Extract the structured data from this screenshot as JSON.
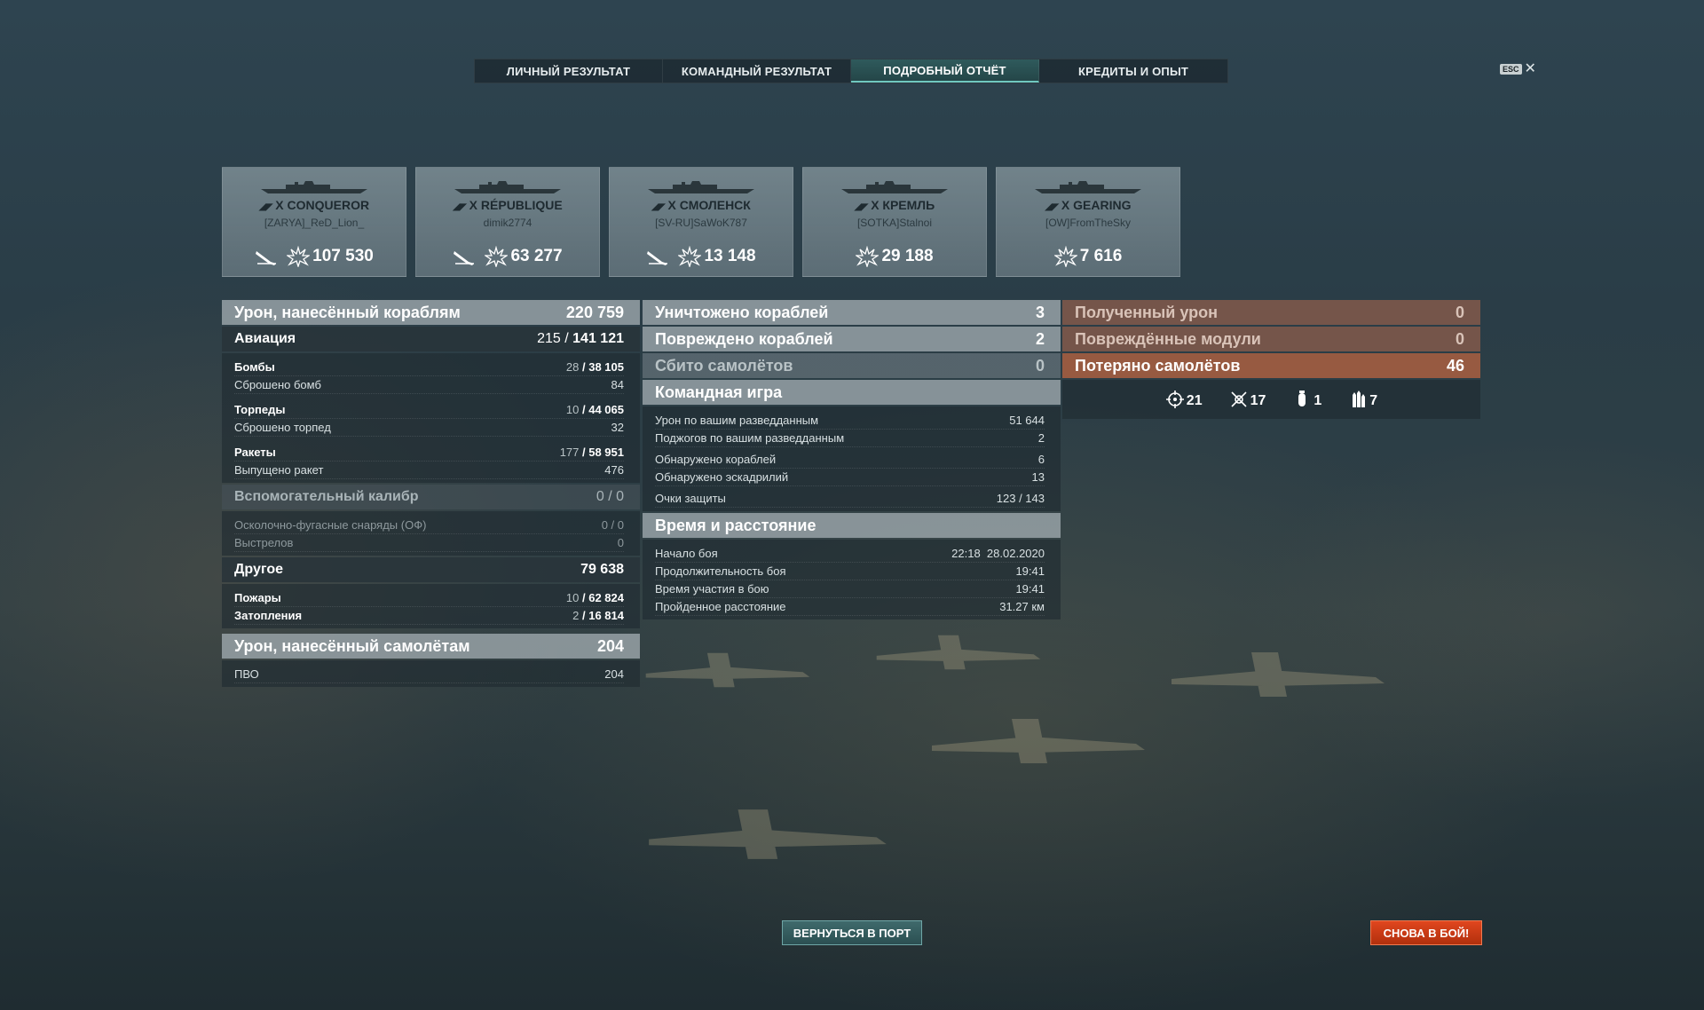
{
  "tabs": [
    {
      "label": "ЛИЧНЫЙ РЕЗУЛЬТАТ",
      "active": false
    },
    {
      "label": "КОМАНДНЫЙ РЕЗУЛЬТАТ",
      "active": false
    },
    {
      "label": "ПОДРОБНЫЙ ОТЧЁТ",
      "active": true
    },
    {
      "label": "КРЕДИТЫ И ОПЫТ",
      "active": false
    }
  ],
  "close": {
    "key": "ESC",
    "icon": "close-icon"
  },
  "ships": [
    {
      "tier": "X",
      "name": "CONQUEROR",
      "player": "[ZARYA]_ReD_Lion_",
      "damage": "107 530",
      "kill": true
    },
    {
      "tier": "X",
      "name": "RÉPUBLIQUE",
      "player": "dimik2774",
      "damage": "63 277",
      "kill": true
    },
    {
      "tier": "X",
      "name": "СМОЛЕНСК",
      "player": "[SV-RU]SaWoK787",
      "damage": "13 148",
      "kill": true
    },
    {
      "tier": "X",
      "name": "КРЕМЛЬ",
      "player": "[SOTKA]Stalnoi",
      "damage": "29 188",
      "kill": false
    },
    {
      "tier": "X",
      "name": "GEARING",
      "player": "[OW]FromTheSky",
      "damage": "7 616",
      "kill": false
    }
  ],
  "col1": {
    "ship_damage": {
      "label": "Урон, нанесённый кораблям",
      "value": "220 759"
    },
    "aviation": {
      "label": "Авиация",
      "hits": "215",
      "damage": "141 121"
    },
    "bombs": {
      "label": "Бомбы",
      "hits": "28",
      "damage": "38 105"
    },
    "bombs_dropped": {
      "label": "Сброшено бомб",
      "value": "84"
    },
    "torpedoes": {
      "label": "Торпеды",
      "hits": "10",
      "damage": "44 065"
    },
    "torpedoes_dropped": {
      "label": "Сброшено торпед",
      "value": "32"
    },
    "rockets": {
      "label": "Ракеты",
      "hits": "177",
      "damage": "58 951"
    },
    "rockets_fired": {
      "label": "Выпущено ракет",
      "value": "476"
    },
    "secondary": {
      "label": "Вспомогательный калибр",
      "value": "0 / 0"
    },
    "he_shells": {
      "label": "Осколочно-фугасные снаряды (ОФ)",
      "value": "0 / 0"
    },
    "shots": {
      "label": "Выстрелов",
      "value": "0"
    },
    "other": {
      "label": "Другое",
      "value": "79 638"
    },
    "fires": {
      "label": "Пожары",
      "hits": "10",
      "damage": "62 824"
    },
    "floods": {
      "label": "Затопления",
      "hits": "2",
      "damage": "16 814"
    },
    "plane_damage": {
      "label": "Урон, нанесённый самолётам",
      "value": "204"
    },
    "aa": {
      "label": "ПВО",
      "value": "204"
    }
  },
  "col2": {
    "destroyed": {
      "label": "Уничтожено кораблей",
      "value": "3"
    },
    "damaged": {
      "label": "Повреждено кораблей",
      "value": "2"
    },
    "planes_shot": {
      "label": "Сбито самолётов",
      "value": "0"
    },
    "team": {
      "label": "Командная игра"
    },
    "spot_damage": {
      "label": "Урон по вашим разведданным",
      "value": "51 644"
    },
    "spot_fires": {
      "label": "Поджогов по вашим разведданным",
      "value": "2"
    },
    "spotted_ships": {
      "label": "Обнаружено кораблей",
      "value": "6"
    },
    "spotted_squads": {
      "label": "Обнаружено эскадрилий",
      "value": "13"
    },
    "defense": {
      "label": "Очки защиты",
      "value": "123 / 143"
    },
    "time": {
      "label": "Время и расстояние"
    },
    "start": {
      "label": "Начало боя",
      "value": "22:18  28.02.2020"
    },
    "duration": {
      "label": "Продолжительность боя",
      "value": "19:41"
    },
    "participation": {
      "label": "Время участия в бою",
      "value": "19:41"
    },
    "distance": {
      "label": "Пройденное расстояние",
      "value": "31.27 км"
    }
  },
  "col3": {
    "received": {
      "label": "Полученный урон",
      "value": "0"
    },
    "modules": {
      "label": "Повреждённые модули",
      "value": "0"
    },
    "lost_planes": {
      "label": "Потеряно самолётов",
      "value": "46"
    },
    "ribbons": [
      {
        "icon": "crosshair-icon",
        "value": "21"
      },
      {
        "icon": "plane-shot-icon",
        "value": "17"
      },
      {
        "icon": "bomb-icon",
        "value": "1"
      },
      {
        "icon": "rockets-icon",
        "value": "7"
      }
    ]
  },
  "buttons": {
    "port": "ВЕРНУТЬСЯ В ПОРТ",
    "battle": "СНОВА В БОЙ!"
  },
  "colors": {
    "accent": "#6fc8c0",
    "battle_button": "#d43c18",
    "received_panel": "#aa5f41"
  }
}
